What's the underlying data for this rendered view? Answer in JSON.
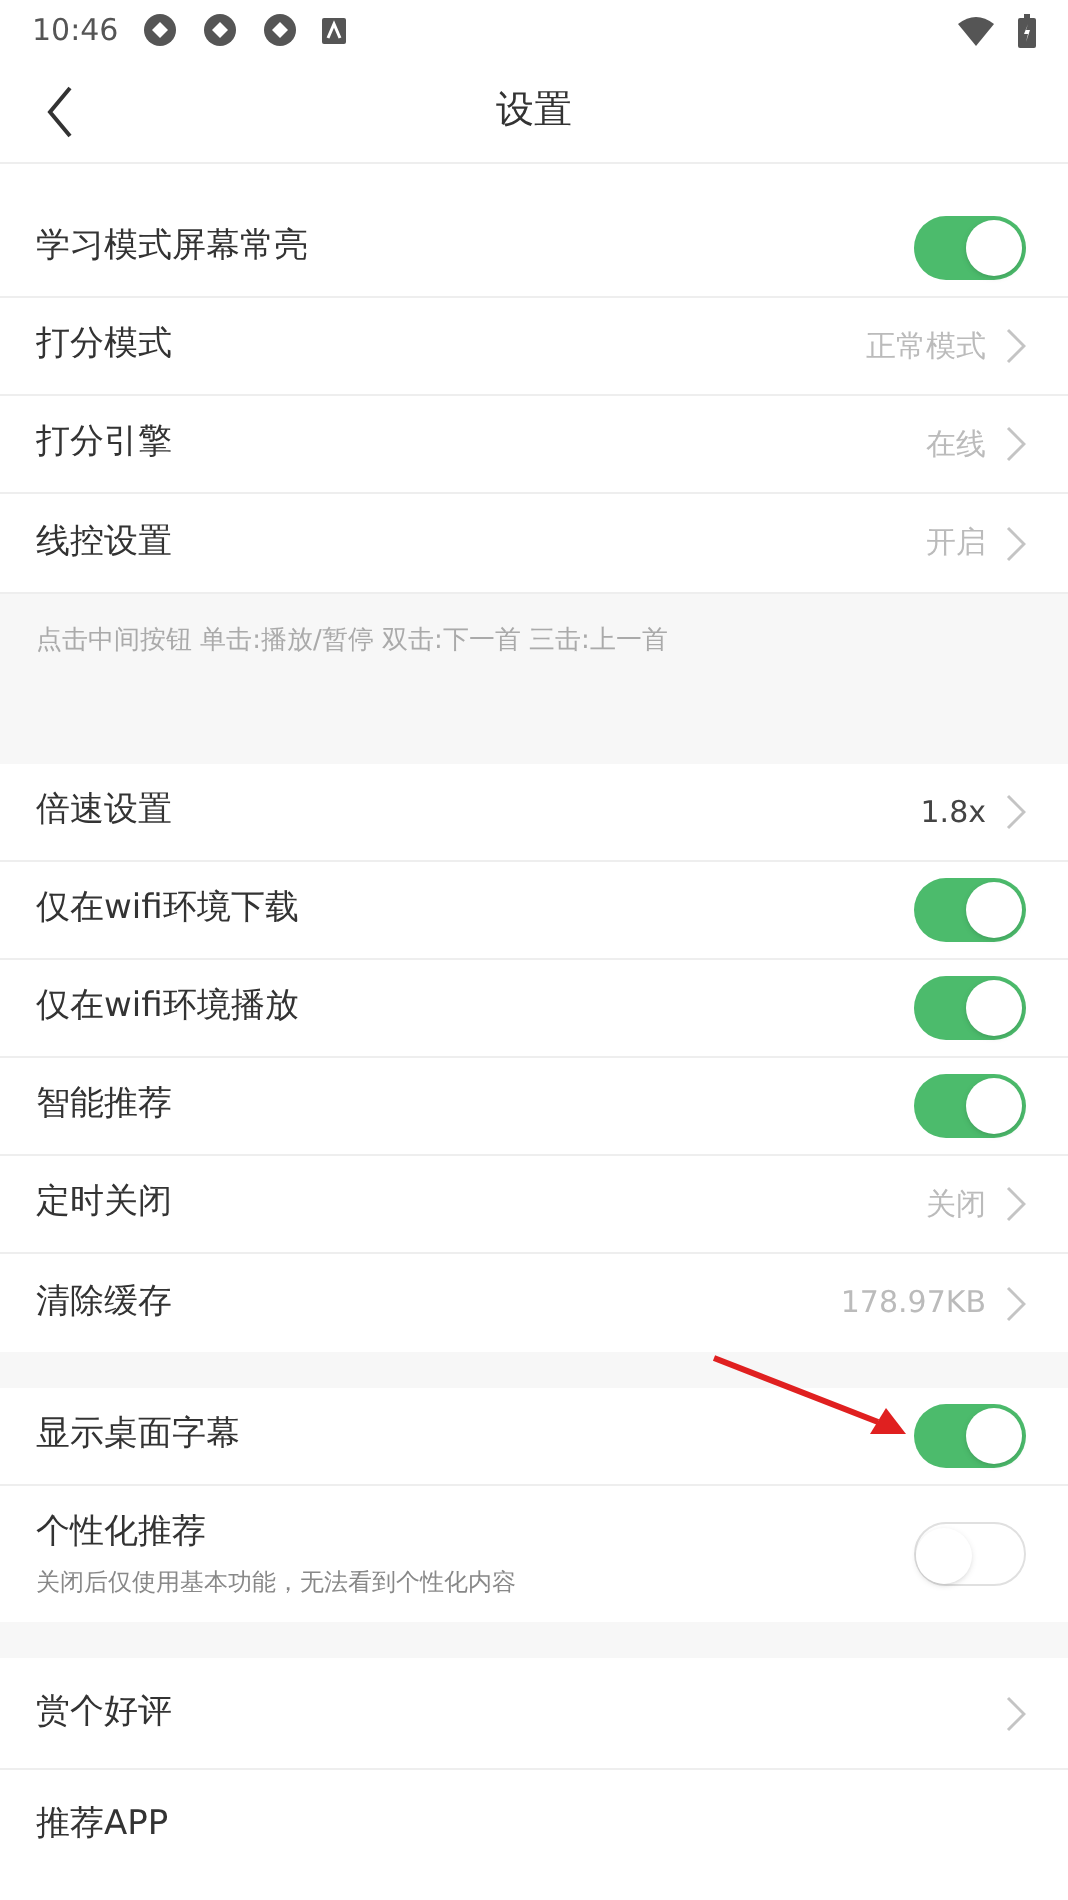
{
  "status_bar": {
    "time": "10:46"
  },
  "header": {
    "title": "设置"
  },
  "sections": [
    {
      "items": [
        {
          "kind": "toggle",
          "label": "学习模式屏幕常亮",
          "on": true
        },
        {
          "kind": "link",
          "label": "打分模式",
          "value": "正常模式",
          "muted": true
        },
        {
          "kind": "link",
          "label": "打分引擎",
          "value": "在线",
          "muted": true
        },
        {
          "kind": "link",
          "label": "线控设置",
          "value": "开启",
          "muted": true
        }
      ],
      "note": "点击中间按钮 单击:播放/暂停 双击:下一首 三击:上一首"
    },
    {
      "items": [
        {
          "kind": "link",
          "label": "倍速设置",
          "value": "1.8x",
          "muted": false
        },
        {
          "kind": "toggle",
          "label": "仅在wifi环境下载",
          "on": true
        },
        {
          "kind": "toggle",
          "label": "仅在wifi环境播放",
          "on": true
        },
        {
          "kind": "toggle",
          "label": "智能推荐",
          "on": true
        },
        {
          "kind": "link",
          "label": "定时关闭",
          "value": "关闭",
          "muted": true
        },
        {
          "kind": "link",
          "label": "清除缓存",
          "value": "178.97KB",
          "muted": true
        }
      ]
    },
    {
      "items": [
        {
          "kind": "toggle",
          "label": "显示桌面字幕",
          "on": true,
          "annotated": true
        },
        {
          "kind": "toggle",
          "label": "个性化推荐",
          "subtitle": "关闭后仅使用基本功能，无法看到个性化内容",
          "on": false
        }
      ]
    },
    {
      "items": [
        {
          "kind": "link",
          "label": "赏个好评",
          "tall": true
        },
        {
          "kind": "link",
          "label": "推荐APP",
          "tall": true,
          "hide_chevron": true
        }
      ]
    }
  ]
}
